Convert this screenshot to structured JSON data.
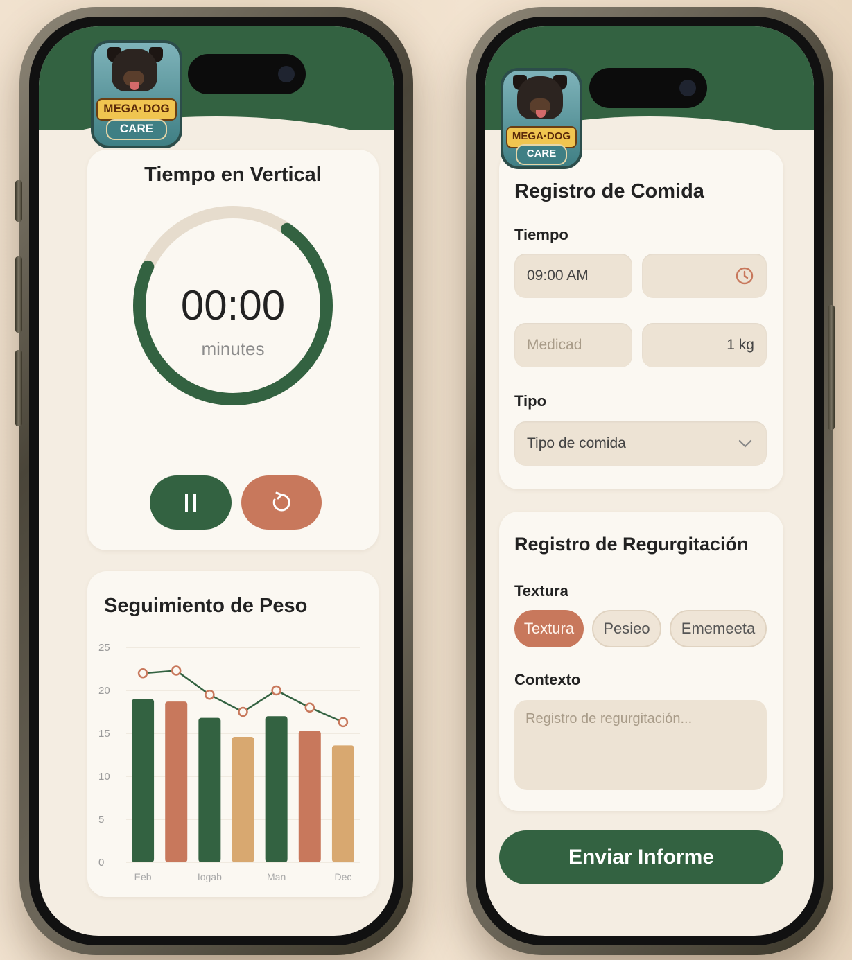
{
  "brand": {
    "line1": "MEGA·DOG",
    "line2": "CARE"
  },
  "colors": {
    "green": "#336241",
    "terracotta": "#c8785c",
    "sand": "#d8a870",
    "ring_track": "#e6dccd"
  },
  "left_screen": {
    "timer_card": {
      "title": "Tiempo en Vertical",
      "time": "00:00",
      "unit": "minutes",
      "pause_icon": "pause-icon",
      "reset_icon": "reset-icon",
      "progress": 0.72
    },
    "weight_card": {
      "title": "Seguimiento de Peso"
    }
  },
  "chart_data": {
    "type": "bar",
    "title": "Seguimiento de Peso",
    "ylim": [
      0,
      25
    ],
    "yticks": [
      "0",
      "5",
      "10",
      "15",
      "20",
      "25"
    ],
    "x_tick_labels": [
      "Eeb",
      "Iogab",
      "Man",
      "Dec"
    ],
    "bars": [
      19,
      18.7,
      16.8,
      14.6,
      17,
      15.3,
      13.6
    ],
    "bar_colors": [
      "#336241",
      "#c8785c",
      "#336241",
      "#d8a870",
      "#336241",
      "#c8785c",
      "#d8a870"
    ],
    "line": [
      22,
      22.3,
      19.5,
      17.5,
      20,
      18,
      16.3
    ],
    "grid": true
  },
  "right_screen": {
    "food_card": {
      "title": "Registro de Comida",
      "time_label": "Tiempo",
      "time_value": "09:00 AM",
      "clock_icon": "clock-icon",
      "measure_placeholder": "Medicad",
      "weight_value": "1 kg",
      "type_label": "Tipo",
      "type_select": "Tipo de comida",
      "chevron_icon": "chevron-down-icon"
    },
    "regurg_card": {
      "title": "Registro de Regurgitación",
      "texture_label": "Textura",
      "chips": [
        "Textura",
        "Pesieo",
        "Ememeeta"
      ],
      "context_label": "Contexto",
      "context_placeholder": "Registro de regurgitación..."
    },
    "submit_label": "Enviar Informe"
  }
}
